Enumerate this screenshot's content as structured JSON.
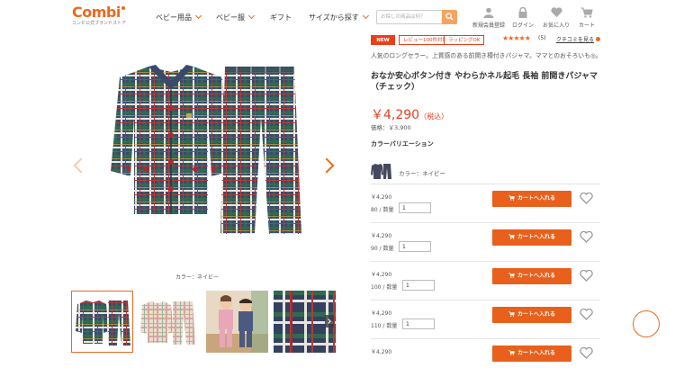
{
  "header": {
    "logo_text": "Combi",
    "logo_tagline": "コンビ公式ブランドストア",
    "nav": [
      "ベビー用品",
      "ベビー服",
      "ギフト",
      "サイズから探す"
    ],
    "search_placeholder": "お探しの商品は何？",
    "icons": [
      {
        "name": "register",
        "label": "新規会員登録"
      },
      {
        "name": "login",
        "label": "ログイン"
      },
      {
        "name": "favorites",
        "label": "お気に入り"
      },
      {
        "name": "cart",
        "label": "カート"
      }
    ],
    "accent": "#ea6a1f"
  },
  "gallery": {
    "caption": "カラー：ネイビー",
    "thumbs": [
      "navy-pajama",
      "beige-pajama",
      "kids-photo",
      "fabric-closeup"
    ]
  },
  "product": {
    "badges": [
      "NEW",
      "レビュー100件対象",
      "ラッピングOK"
    ],
    "rating_stars": "★★★★★",
    "rating": 4.5,
    "review_count": "(5)",
    "review_link": "クチコミを見る",
    "lead": "人気のロングセラー。上質感のある前開き樽付きパジャマ。ママとのおそろいも◎。",
    "title": "おなか安心ボタン付き やわらかネル起毛 長袖 前開きパジャマ（チェック）",
    "price": "￥4,290",
    "price_tax": "（税込）",
    "base_price": "価格：￥3,900",
    "variation_heading": "カラーバリエーション",
    "color_label": "カラー：ネイビー",
    "price_color": "#e8401c"
  },
  "sizes": [
    {
      "price": "￥4,290",
      "size": "80 /",
      "qty_label": "数量",
      "qty": "1"
    },
    {
      "price": "￥4,290",
      "size": "90 /",
      "qty_label": "数量",
      "qty": "1"
    },
    {
      "price": "￥4,290",
      "size": "100 /",
      "qty_label": "数量",
      "qty": "1"
    },
    {
      "price": "￥4,290",
      "size": "110 /",
      "qty_label": "数量",
      "qty": "1"
    },
    {
      "price": "￥4,290",
      "size": "",
      "qty_label": "",
      "qty": ""
    }
  ],
  "cart_button_label": "カートへ入れる"
}
